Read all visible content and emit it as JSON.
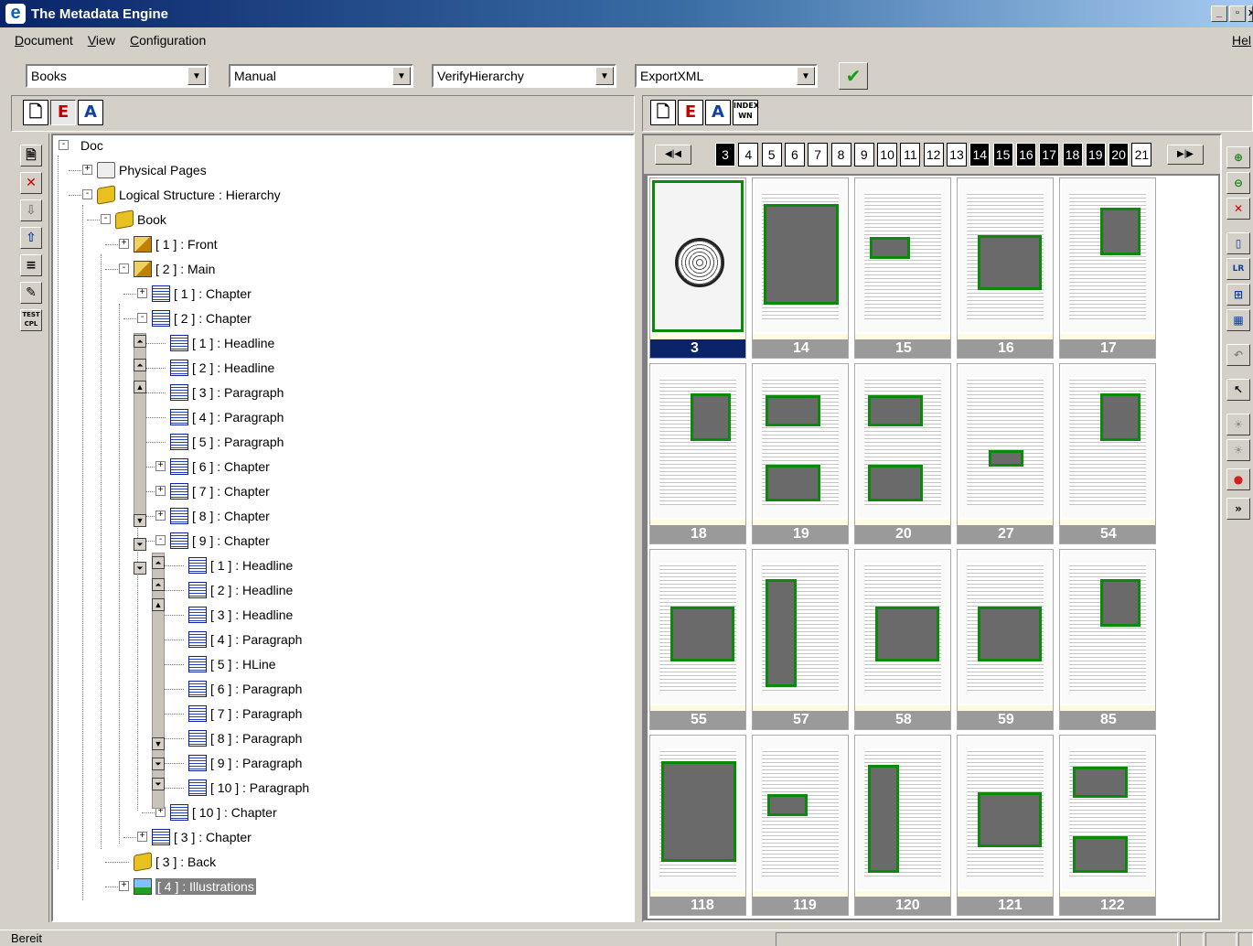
{
  "window": {
    "title": "The Metadata Engine",
    "buttons": [
      "_",
      "4",
      "x"
    ]
  },
  "menu": {
    "document": "Document",
    "document_rest": "ocument",
    "view": "View",
    "view_rest": "iew",
    "configuration": "Configuration",
    "configuration_rest": "onfiguration",
    "help": "Hel"
  },
  "combos": [
    {
      "value": "Books"
    },
    {
      "value": "Manual"
    },
    {
      "value": "VerifyHierarchy"
    },
    {
      "value": "ExportXML"
    }
  ],
  "right_toolbar_index_btn": "INDEX WN",
  "tree": [
    {
      "label": "Doc",
      "level": 0,
      "icon": "none",
      "expander": "-"
    },
    {
      "label": "Physical Pages",
      "level": 1,
      "icon": "pages-icon",
      "expander": "+"
    },
    {
      "label": "Logical Structure : Hierarchy",
      "level": 1,
      "icon": "book-icon",
      "expander": "-"
    },
    {
      "label": "Book",
      "level": 2,
      "icon": "book-icon",
      "expander": "-"
    },
    {
      "label": "[ 1 ] : Front",
      "level": 3,
      "icon": "struct-icon",
      "expander": "+"
    },
    {
      "label": "[ 2 ] : Main",
      "level": 3,
      "icon": "struct-icon",
      "expander": "-"
    },
    {
      "label": "[ 1 ] : Chapter",
      "level": 4,
      "icon": "doc-icon",
      "expander": "+"
    },
    {
      "label": "[ 2 ] : Chapter",
      "level": 4,
      "icon": "doc-icon",
      "expander": "-"
    },
    {
      "label": "[ 1 ] : Headline",
      "level": 5,
      "icon": "doc-icon",
      "expander": ""
    },
    {
      "label": "[ 2 ] : Headline",
      "level": 5,
      "icon": "doc-icon",
      "expander": ""
    },
    {
      "label": "[ 3 ] : Paragraph",
      "level": 5,
      "icon": "doc-icon",
      "expander": ""
    },
    {
      "label": "[ 4 ] : Paragraph",
      "level": 5,
      "icon": "doc-icon",
      "expander": ""
    },
    {
      "label": "[ 5 ] : Paragraph",
      "level": 5,
      "icon": "doc-icon",
      "expander": ""
    },
    {
      "label": "[ 6 ] : Chapter",
      "level": 5,
      "icon": "doc-icon",
      "expander": "+"
    },
    {
      "label": "[ 7 ] : Chapter",
      "level": 5,
      "icon": "doc-icon",
      "expander": "+"
    },
    {
      "label": "[ 8 ] : Chapter",
      "level": 5,
      "icon": "doc-icon",
      "expander": "+"
    },
    {
      "label": "[ 9 ] : Chapter",
      "level": 5,
      "icon": "doc-icon",
      "expander": "-"
    },
    {
      "label": "[ 1 ] : Headline",
      "level": 6,
      "icon": "doc-icon",
      "expander": ""
    },
    {
      "label": "[ 2 ] : Headline",
      "level": 6,
      "icon": "doc-icon",
      "expander": ""
    },
    {
      "label": "[ 3 ] : Headline",
      "level": 6,
      "icon": "doc-icon",
      "expander": ""
    },
    {
      "label": "[ 4 ] : Paragraph",
      "level": 6,
      "icon": "doc-icon",
      "expander": ""
    },
    {
      "label": "[ 5 ] : HLine",
      "level": 6,
      "icon": "doc-icon",
      "expander": ""
    },
    {
      "label": "[ 6 ] : Paragraph",
      "level": 6,
      "icon": "doc-icon",
      "expander": ""
    },
    {
      "label": "[ 7 ] : Paragraph",
      "level": 6,
      "icon": "doc-icon",
      "expander": ""
    },
    {
      "label": "[ 8 ] : Paragraph",
      "level": 6,
      "icon": "doc-icon",
      "expander": ""
    },
    {
      "label": "[ 9 ] : Paragraph",
      "level": 6,
      "icon": "doc-icon",
      "expander": ""
    },
    {
      "label": "[ 10 ] : Paragraph",
      "level": 6,
      "icon": "doc-icon",
      "expander": ""
    },
    {
      "label": "[ 10 ] : Chapter",
      "level": 5,
      "icon": "doc-icon",
      "expander": "+"
    },
    {
      "label": "[ 3 ] : Chapter",
      "level": 4,
      "icon": "doc-icon",
      "expander": "+"
    },
    {
      "label": "[ 3 ] : Back",
      "level": 3,
      "icon": "book-icon",
      "expander": ""
    },
    {
      "label": "[ 4 ] : Illustrations",
      "level": 3,
      "icon": "illustration-icon",
      "expander": "+",
      "selected": true
    }
  ],
  "page_tabs": [
    {
      "label": "3",
      "dark": true
    },
    {
      "label": "4"
    },
    {
      "label": "5"
    },
    {
      "label": "6"
    },
    {
      "label": "7"
    },
    {
      "label": "8"
    },
    {
      "label": "9"
    },
    {
      "label": "10"
    },
    {
      "label": "11"
    },
    {
      "label": "12"
    },
    {
      "label": "13"
    },
    {
      "label": "14",
      "dark": true
    },
    {
      "label": "15",
      "dark": true
    },
    {
      "label": "16",
      "dark": true
    },
    {
      "label": "17",
      "dark": true
    },
    {
      "label": "18",
      "dark": true
    },
    {
      "label": "19",
      "dark": true
    },
    {
      "label": "20",
      "dark": true
    },
    {
      "label": "21"
    }
  ],
  "thumbnails": [
    {
      "page": "3",
      "active": true,
      "cover": true
    },
    {
      "page": "14",
      "img": "full"
    },
    {
      "page": "15",
      "img": "small"
    },
    {
      "page": "16",
      "img": "mid"
    },
    {
      "page": "17",
      "img": "portrait"
    },
    {
      "page": "18",
      "img": "portrait"
    },
    {
      "page": "19",
      "img": "two"
    },
    {
      "page": "20",
      "img": "two"
    },
    {
      "page": "27",
      "img": "tiny"
    },
    {
      "page": "54",
      "img": "portrait"
    },
    {
      "page": "55",
      "img": "mid"
    },
    {
      "page": "57",
      "img": "tall"
    },
    {
      "page": "58",
      "img": "mid"
    },
    {
      "page": "59",
      "img": "mid"
    },
    {
      "page": "85",
      "img": "portrait"
    },
    {
      "page": "118",
      "img": "full"
    },
    {
      "page": "119",
      "img": "small"
    },
    {
      "page": "120",
      "img": "tall"
    },
    {
      "page": "121",
      "img": "mid"
    },
    {
      "page": "122",
      "img": "two"
    }
  ],
  "status": {
    "text": "Bereit"
  }
}
